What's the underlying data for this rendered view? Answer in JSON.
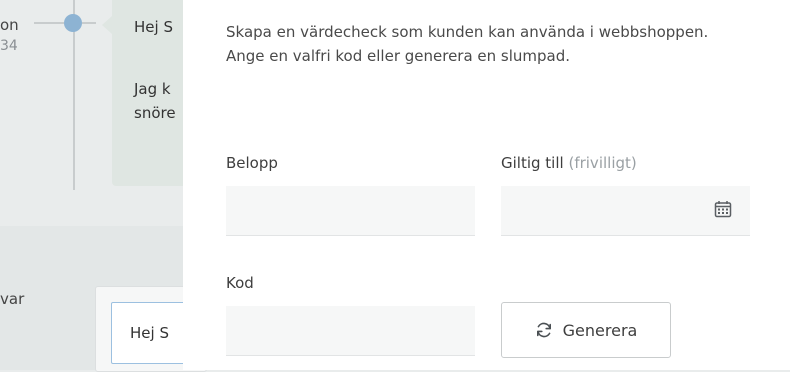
{
  "background": {
    "timeline_name": "on",
    "timeline_time": "34",
    "message_lines": [
      "Hej S",
      "Jag k",
      "snöre"
    ],
    "var_text": "var",
    "reply_text": "Hej S"
  },
  "panel": {
    "description": "Skapa en värdecheck som kunden kan använda i webbshoppen. Ange en valfri kod eller generera en slumpad.",
    "amount_label": "Belopp",
    "valid_until_label": "Giltig till",
    "valid_until_optional": "(frivilligt)",
    "code_label": "Kod",
    "generate_button": "Generera",
    "amount_value": "",
    "valid_until_value": "",
    "code_value": ""
  },
  "icons": {
    "calendar": "calendar-icon",
    "refresh": "refresh-icon"
  }
}
